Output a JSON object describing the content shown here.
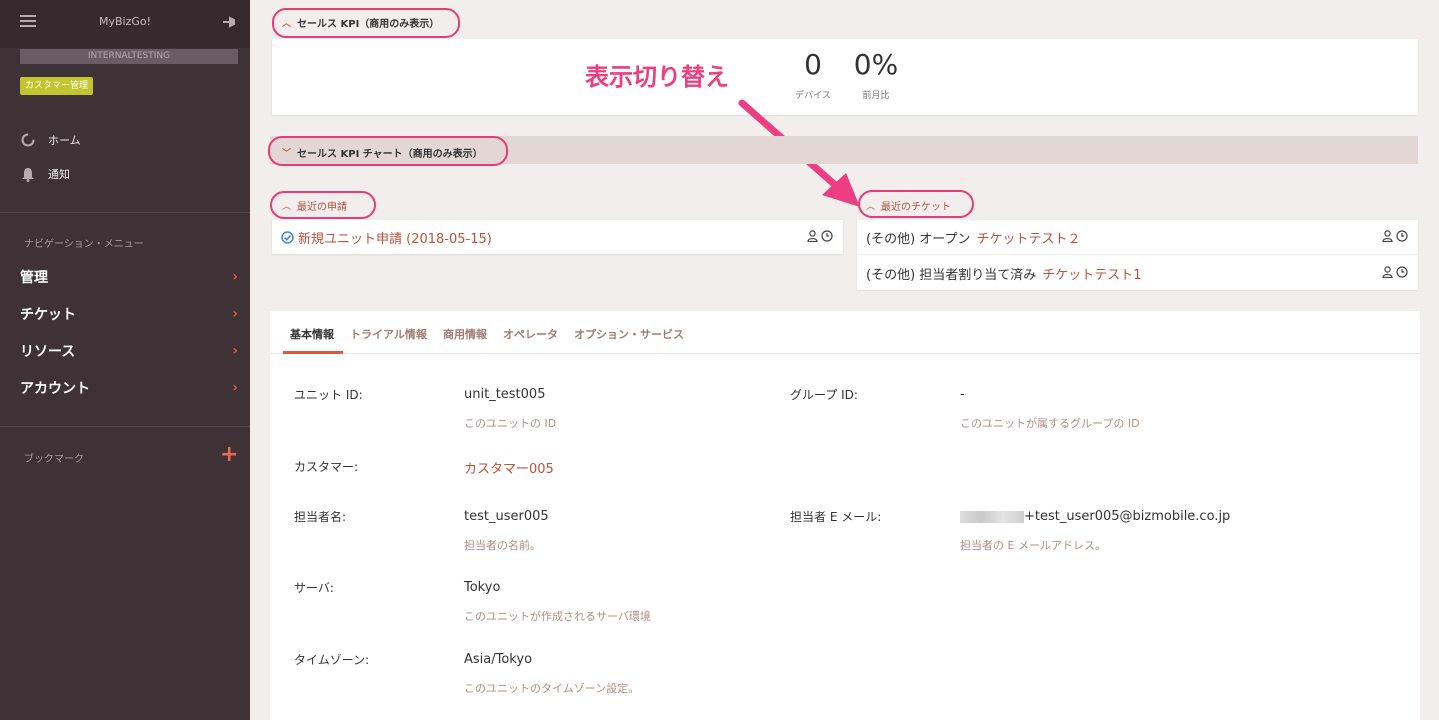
{
  "sidebar": {
    "app_title": "MyBizGo!",
    "tenant": "INTERNALTESTING",
    "badge": "カスタマー管理",
    "quick": [
      {
        "label": "ホーム",
        "icon": "home-circle-icon"
      },
      {
        "label": "通知",
        "icon": "bell-icon"
      }
    ],
    "nav_section": "ナビゲーション・メニュー",
    "nav": [
      {
        "label": "管理"
      },
      {
        "label": "チケット"
      },
      {
        "label": "リソース"
      },
      {
        "label": "アカウント"
      }
    ],
    "bookmark_label": "ブックマーク"
  },
  "sales_kpi": {
    "title": "セールス KPI（商用のみ表示）",
    "devices_value": "0",
    "devices_label": "デバイス",
    "mom_value": "0%",
    "mom_label": "前月比"
  },
  "annotation": "表示切り替え",
  "sales_chart": {
    "title": "セールス KPI チャート（商用のみ表示）"
  },
  "recent_requests": {
    "title": "最近の申請",
    "items": [
      {
        "text": "新規ユニット申請 (2018-05-15)"
      }
    ]
  },
  "recent_tickets": {
    "title": "最近のチケット",
    "items": [
      {
        "prefix": "(その他) オープン",
        "link": "チケットテスト２"
      },
      {
        "prefix": "(その他) 担当者割り当て済み",
        "link": "チケットテスト1"
      }
    ]
  },
  "tabs": [
    "基本情報",
    "トライアル情報",
    "商用情報",
    "オペレータ",
    "オプション・サービス"
  ],
  "fields": {
    "unit_id": {
      "label": "ユニット ID:",
      "value": "unit_test005",
      "help": "このユニットの ID"
    },
    "group_id": {
      "label": "グループ ID:",
      "value": "-",
      "help": "このユニットが属するグループの ID"
    },
    "customer": {
      "label": "カスタマー:",
      "value": "カスタマー005"
    },
    "owner_name": {
      "label": "担当者名:",
      "value": "test_user005",
      "help": "担当者の名前。"
    },
    "owner_email": {
      "label": "担当者 E メール:",
      "value": "+test_user005@bizmobile.co.jp",
      "help": "担当者の E メールアドレス。"
    },
    "server": {
      "label": "サーバ:",
      "value": "Tokyo",
      "help": "このユニットが作成されるサーバ環境"
    },
    "timezone": {
      "label": "タイムゾーン:",
      "value": "Asia/Tokyo",
      "help": "このユニットのタイムゾーン設定。"
    }
  }
}
